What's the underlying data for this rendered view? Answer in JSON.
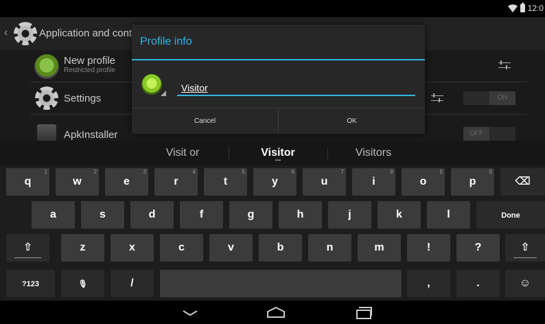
{
  "status": {
    "time": "12:0"
  },
  "actionbar": {
    "back_glyph": "‹",
    "title": "Application and conte"
  },
  "rows": [
    {
      "title": "New profile",
      "subtitle": "Restricted profile"
    },
    {
      "title": "Settings",
      "toggle": "ON"
    },
    {
      "title": "ApkInstaller",
      "toggle": "OFF"
    }
  ],
  "dialog": {
    "title": "Profile info",
    "input_value": "Visitor",
    "cancel_label": "Cancel",
    "ok_label": "OK"
  },
  "suggestions": [
    "Visit or",
    "Visitor",
    "Visitors"
  ],
  "keys": {
    "row1": [
      {
        "k": "q",
        "hint": "1"
      },
      {
        "k": "w",
        "hint": "2"
      },
      {
        "k": "e",
        "hint": "3"
      },
      {
        "k": "r",
        "hint": "4"
      },
      {
        "k": "t",
        "hint": "5"
      },
      {
        "k": "y",
        "hint": "6"
      },
      {
        "k": "u",
        "hint": "7"
      },
      {
        "k": "i",
        "hint": "8"
      },
      {
        "k": "o",
        "hint": "9"
      },
      {
        "k": "p",
        "hint": "0"
      }
    ],
    "row2": [
      "a",
      "s",
      "d",
      "f",
      "g",
      "h",
      "j",
      "k",
      "l"
    ],
    "done": "Done",
    "row3": [
      "z",
      "x",
      "c",
      "v",
      "b",
      "n",
      "m",
      "!",
      "?"
    ],
    "shift_glyph": "⇧",
    "symbols": "?123",
    "slash": "/",
    "comma": ",",
    "period": ".",
    "backspace_glyph": "⌫",
    "smiley_glyph": "☺",
    "mic_glyph": "🎙",
    "hint_dots": "..."
  },
  "icons": {
    "back": "chevron-down-icon",
    "home": "home-icon",
    "recents": "recents-icon"
  },
  "colors": {
    "accent": "#33b5e5"
  }
}
